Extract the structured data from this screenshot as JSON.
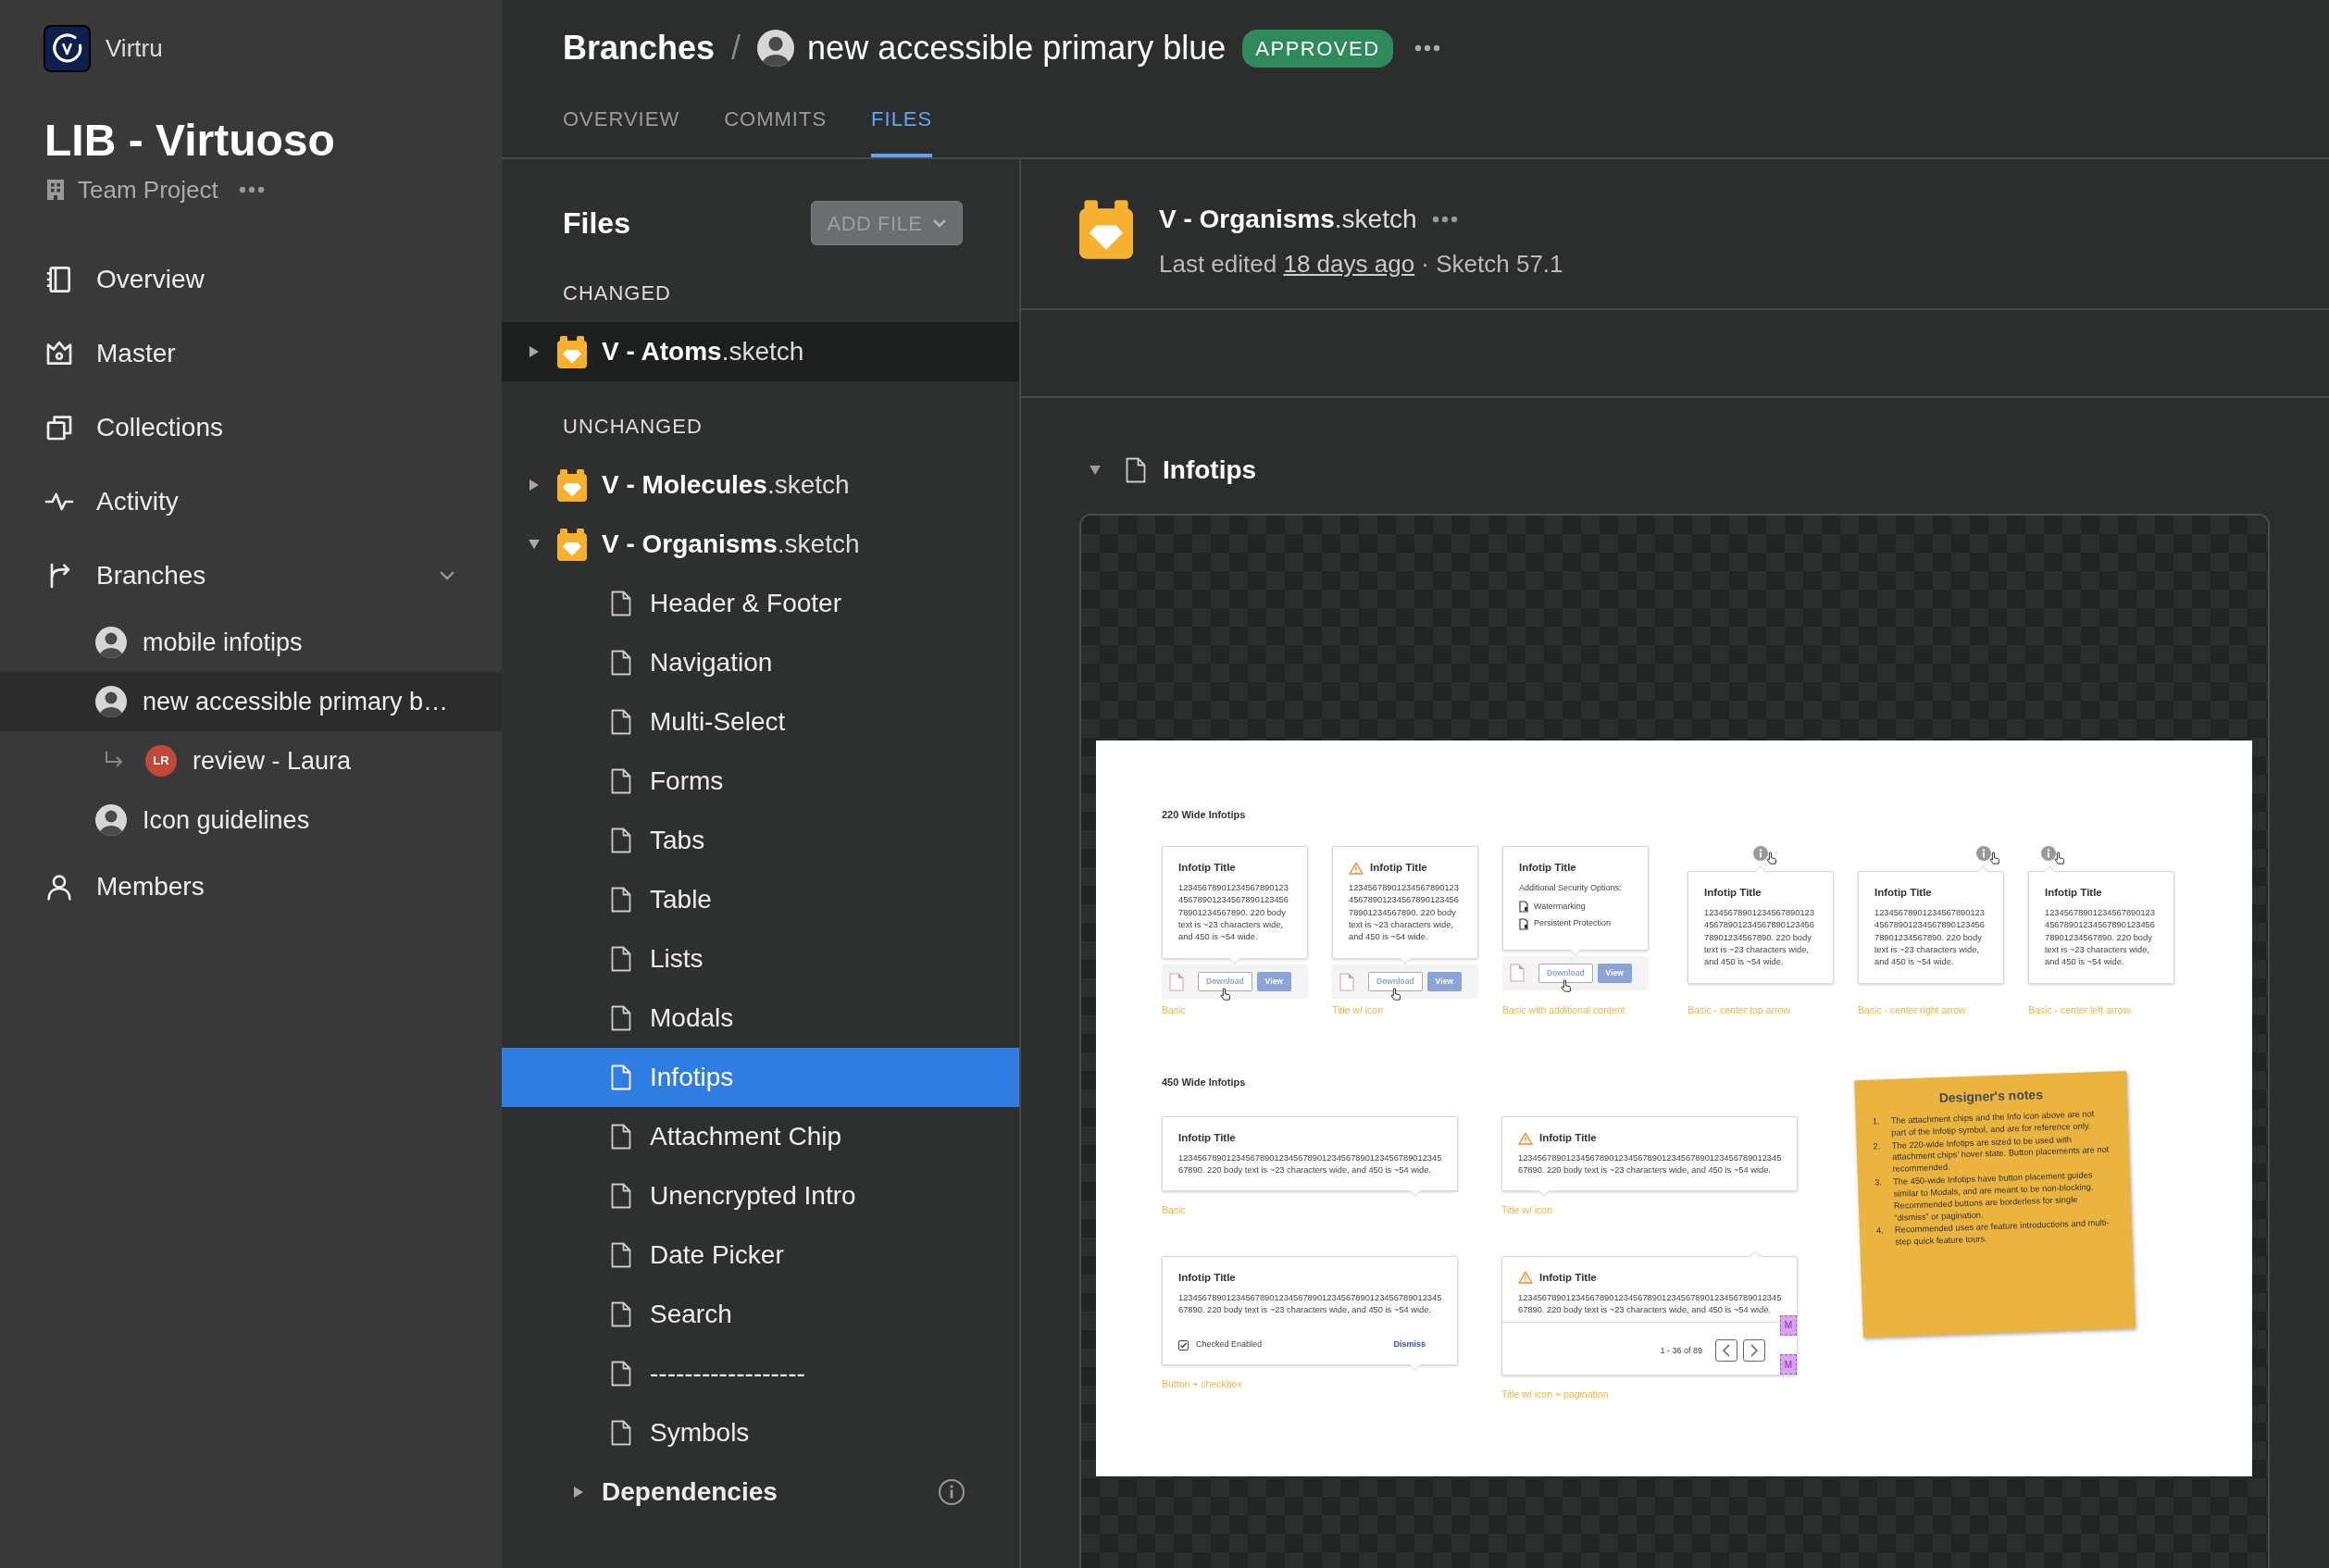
{
  "sidebar": {
    "org": "Virtru",
    "project": "LIB - Virtuoso",
    "project_type": "Team Project",
    "nav": [
      {
        "label": "Overview"
      },
      {
        "label": "Master"
      },
      {
        "label": "Collections"
      },
      {
        "label": "Activity"
      },
      {
        "label": "Branches",
        "expanded": true,
        "children": [
          {
            "label": "mobile infotips",
            "selected": false
          },
          {
            "label": "new accessible primary b…",
            "selected": true,
            "children": [
              {
                "label": "review - Laura",
                "initials": "LR",
                "selected": false
              }
            ]
          },
          {
            "label": "Icon guidelines",
            "selected": false
          }
        ]
      },
      {
        "label": "Members"
      }
    ]
  },
  "header": {
    "breadcrumb": "Branches",
    "separator": "/",
    "branch": "new accessible primary blue",
    "status": "APPROVED",
    "tabs": [
      {
        "label": "OVERVIEW",
        "selected": false
      },
      {
        "label": "COMMITS",
        "selected": false
      },
      {
        "label": "FILES",
        "selected": true
      }
    ]
  },
  "files_panel": {
    "title": "Files",
    "add_button": {
      "label": "ADD FILE",
      "disabled": true
    },
    "groups": [
      {
        "title": "CHANGED",
        "files": [
          {
            "name": "**V - Atoms**.sketch",
            "expanded": false,
            "hovered": true
          }
        ]
      },
      {
        "title": "UNCHANGED",
        "files": [
          {
            "name": "**V - Molecules**.sketch",
            "expanded": false,
            "hovered": false
          },
          {
            "name": "**V - Organisms**.sketch",
            "expanded": true,
            "hovered": false,
            "pages": [
              {
                "label": "Header & Footer",
                "selected": false
              },
              {
                "label": "Navigation",
                "selected": false
              },
              {
                "label": "Multi-Select",
                "selected": false
              },
              {
                "label": "Forms",
                "selected": false
              },
              {
                "label": "Tabs",
                "selected": false
              },
              {
                "label": "Table",
                "selected": false
              },
              {
                "label": "Lists",
                "selected": false
              },
              {
                "label": "Modals",
                "selected": false
              },
              {
                "label": "Infotips",
                "selected": true
              },
              {
                "label": "Attachment Chip",
                "selected": false
              },
              {
                "label": "Unencrypted Intro",
                "selected": false
              },
              {
                "label": "Date Picker",
                "selected": false
              },
              {
                "label": "Search",
                "selected": false
              },
              {
                "label": "------------------",
                "selected": false
              },
              {
                "label": "Symbols",
                "selected": false
              }
            ]
          }
        ]
      }
    ],
    "dependencies": {
      "label": "Dependencies",
      "expanded": false
    }
  },
  "document": {
    "name": "**V - Organisms**.sketch",
    "edited_prefix": "Last edited",
    "edited_link": "18 days ago",
    "edited_suffix": "· Sketch 57.1",
    "section": {
      "title": "Infotips",
      "expanded": true
    },
    "artboard": {
      "groups": [
        {
          "title": "220 Wide Infotips",
          "cards": [
            {
              "title": "Infotip Title",
              "warning": false,
              "info_icon": false,
              "body": "123456789012345678901234567890123456789012345678901234567890. 220 body text is ~23 characters wide, and 450 is ~54 wide.",
              "kind": "bottom",
              "chip": {
                "download": "Download",
                "view": "View"
              },
              "caption": "Basic"
            },
            {
              "title": "Infotip Title",
              "warning": true,
              "info_icon": false,
              "body": "123456789012345678901234567890123456789012345678901234567890. 220 body text is ~23 characters wide, and 450 is ~54 wide.",
              "kind": "bottom",
              "chip": {
                "download": "Download",
                "view": "View"
              },
              "caption": "Title w/ icon"
            },
            {
              "title": "Infotip Title",
              "warning": false,
              "info_icon": false,
              "options_title": "Additional Security Options:",
              "options": [
                "Watermarking",
                "Persistent Protection"
              ],
              "kind": "bottom",
              "chip": {
                "download": "Download",
                "view": "View"
              },
              "caption": "Basic with additional content"
            },
            {
              "title": "Infotip Title",
              "warning": false,
              "info_icon": true,
              "body": "123456789012345678901234567890123456789012345678901234567890. 220 body text is ~23 characters wide, and 450 is ~54 wide.",
              "kind": "top",
              "caption": "Basic - center top arrow"
            },
            {
              "title": "Infotip Title",
              "warning": false,
              "info_icon": true,
              "body": "123456789012345678901234567890123456789012345678901234567890. 220 body text is ~23 characters wide, and 450 is ~54 wide.",
              "kind": "topright",
              "caption": "Basic - center right arrow"
            },
            {
              "title": "Infotip Title",
              "warning": false,
              "info_icon": true,
              "body": "123456789012345678901234567890123456789012345678901234567890. 220 body text is ~23 characters wide, and 450 is ~54 wide.",
              "kind": "topleft",
              "caption": "Basic - center left arrow"
            }
          ]
        },
        {
          "title": "450 Wide Infotips",
          "cards": [
            {
              "title": "Infotip Title",
              "warning": false,
              "body": "123456789012345678901234567890123456789012345678901234567890. 220 body text is ~23 characters wide, and 450 is ~54 wide.",
              "kind": "bottomright",
              "caption": "Basic"
            },
            {
              "title": "Infotip Title",
              "warning": true,
              "body": "123456789012345678901234567890123456789012345678901234567890. 220 body text is ~23 characters wide, and 450 is ~54 wide.",
              "kind": "bottomleft",
              "caption": "Title w/ icon"
            },
            {
              "title": "Infotip Title",
              "warning": false,
              "body": "123456789012345678901234567890123456789012345678901234567890. 220 body text is ~23 characters wide, and 450 is ~54 wide.",
              "checkbox": {
                "label": "Checked Enabled",
                "checked": true
              },
              "action": "Dismiss",
              "kind": "bottomright",
              "caption": "Button + checkbox"
            },
            {
              "title": "Infotip Title",
              "warning": true,
              "body": "123456789012345678901234567890123456789012345678901234567890. 220 body text is ~23 characters wide, and 450 is ~54 wide.",
              "pagination": {
                "range": "1 - 36 of 89"
              },
              "markers": [
                "M",
                "M"
              ],
              "kind": "topright",
              "caption": "Title w/ icon + pagination"
            }
          ]
        }
      ],
      "notes": {
        "title": "Designer's notes",
        "items": [
          {
            "number": "1.",
            "text": "The attachment chips and the Info icon above are not part of the Infotip symbol, and are for reference only."
          },
          {
            "number": "2.",
            "text": "The 220-wide Infotips are sized to be used with attachment chips’ hover state. Button placements are not recommended."
          },
          {
            "number": "3.",
            "text": "The 450-wide Infotips have button placement guides similar to Modals, and are meant to be non-blocking. Recommended buttons are borderless for single “dismiss” or pagination."
          },
          {
            "number": "4.",
            "text": "Recommended uses are feature introductions and multi-step quick feature tours."
          }
        ]
      }
    }
  }
}
